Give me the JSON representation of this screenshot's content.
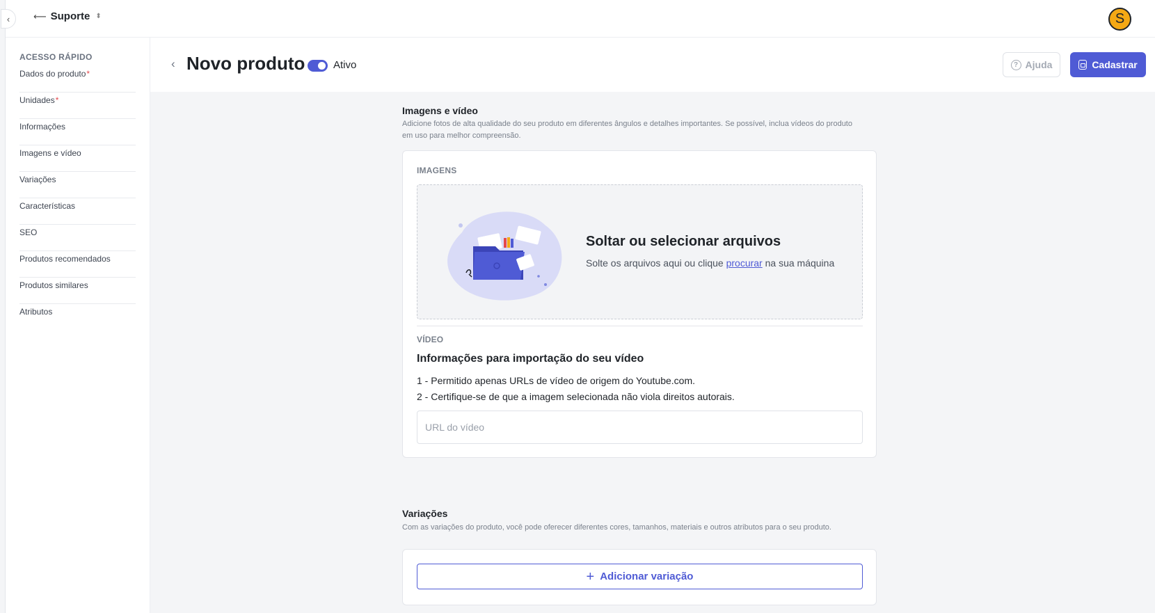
{
  "topbar": {
    "store_name": "Suporte",
    "avatar_initial": "S"
  },
  "sidebar": {
    "heading": "ACESSO RÁPIDO",
    "items": [
      {
        "label": "Dados do produto",
        "required": "*"
      },
      {
        "label": "Unidades",
        "required": "*"
      },
      {
        "label": "Informações",
        "required": ""
      },
      {
        "label": "Imagens e vídeo",
        "required": ""
      },
      {
        "label": "Variações",
        "required": ""
      },
      {
        "label": "Características",
        "required": ""
      },
      {
        "label": "SEO",
        "required": ""
      },
      {
        "label": "Produtos recomendados",
        "required": ""
      },
      {
        "label": "Produtos similares",
        "required": ""
      },
      {
        "label": "Atributos",
        "required": ""
      }
    ]
  },
  "header": {
    "title": "Novo produto",
    "status_label": "Ativo",
    "help_label": "Ajuda",
    "submit_label": "Cadastrar"
  },
  "media": {
    "title": "Imagens e vídeo",
    "description_line1": "Adicione fotos de alta qualidade do seu produto em diferentes ângulos e detalhes importantes. Se possível, inclua vídeos do produto",
    "description_line2": "em uso para melhor compreensão.",
    "images_label": "IMAGENS",
    "dropzone_title": "Soltar ou selecionar arquivos",
    "dropzone_sub_before": "Solte os arquivos aqui ou clique",
    "dropzone_link": "procurar",
    "dropzone_sub_after": "na sua máquina",
    "video_label": "VÍDEO",
    "video_title": "Informações para importação do seu vídeo",
    "video_rule_1": "1 - Permitido apenas URLs de vídeo de origem do Youtube.com.",
    "video_rule_2": "2 - Certifique-se de que a imagem selecionada não viola direitos autorais.",
    "video_url_placeholder": "URL do vídeo",
    "video_url_value": ""
  },
  "variations": {
    "title": "Variações",
    "description": "Com as variações do produto, você pode oferecer diferentes cores, tamanhos, materiais e outros atributos para o seu produto.",
    "add_label": "Adicionar variação"
  },
  "colors": {
    "accent": "#4f5bd5",
    "avatar": "#f4a814",
    "required": "#e5484d"
  },
  "icons": {
    "collapse": "chevron-left-icon",
    "store": "arrow-icon",
    "store_caret": "updown-caret-icon",
    "back": "chevron-left-icon",
    "help": "question-circle-icon",
    "submit": "save-icon",
    "add": "plus-icon"
  }
}
